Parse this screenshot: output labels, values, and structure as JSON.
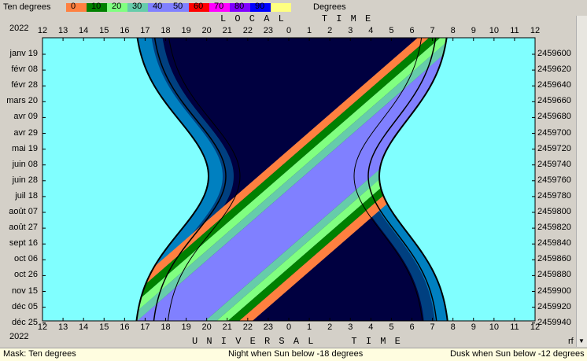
{
  "topbar": {
    "left_label": "Ten degrees",
    "right_label": "Degrees",
    "legend": [
      {
        "value": "0",
        "color": "#ff8040"
      },
      {
        "value": "10",
        "color": "#008000"
      },
      {
        "value": "20",
        "color": "#80ff80"
      },
      {
        "value": "30",
        "color": "#66ccaa"
      },
      {
        "value": "40",
        "color": "#8080ff"
      },
      {
        "value": "50",
        "color": "#8080ff"
      },
      {
        "value": "60",
        "color": "#ff0000"
      },
      {
        "value": "70",
        "color": "#ff00ff"
      },
      {
        "value": "80",
        "color": "#8000ff"
      },
      {
        "value": "90",
        "color": "#0000ff"
      },
      {
        "value": "",
        "color": "#ffff80"
      }
    ]
  },
  "header": {
    "year_top": "2022",
    "year_bottom": "2022",
    "local_time_label": "L O C A L     T I M E",
    "universal_time_label": "U N I V E R S A L     T I M E",
    "corner_label": "rf"
  },
  "hours": [
    "12",
    "13",
    "14",
    "15",
    "16",
    "17",
    "18",
    "19",
    "20",
    "21",
    "22",
    "23",
    "0",
    "1",
    "2",
    "3",
    "4",
    "5",
    "6",
    "7",
    "8",
    "9",
    "10",
    "11",
    "12"
  ],
  "dates": [
    "janv 19",
    "févr 08",
    "févr 28",
    "mars 20",
    "avr 09",
    "avr 29",
    "mai 19",
    "juin 08",
    "juin 28",
    "juil 18",
    "août 07",
    "août 27",
    "sept 16",
    "oct 06",
    "oct 26",
    "nov 15",
    "déc 05",
    "déc 25"
  ],
  "julian_days": [
    "2459600",
    "2459620",
    "2459640",
    "2459660",
    "2459680",
    "2459700",
    "2459720",
    "2459740",
    "2459760",
    "2459780",
    "2459800",
    "2459820",
    "2459840",
    "2459860",
    "2459880",
    "2459900",
    "2459920",
    "2459940"
  ],
  "colors": {
    "day": "#80ffff",
    "night": "#000040",
    "twilight_civil": "#0080c0",
    "twilight_nautical": "#004080",
    "band_orange": "#ff8040",
    "band_green": "#008000",
    "band_lightgreen": "#80ff80",
    "band_teal": "#66ccaa",
    "band_violet": "#8080ff"
  },
  "status": {
    "mask": "Mask:  Ten degrees",
    "night": "Night when Sun below -18 degrees",
    "dusk": "Dusk when Sun below -12 degrees"
  }
}
